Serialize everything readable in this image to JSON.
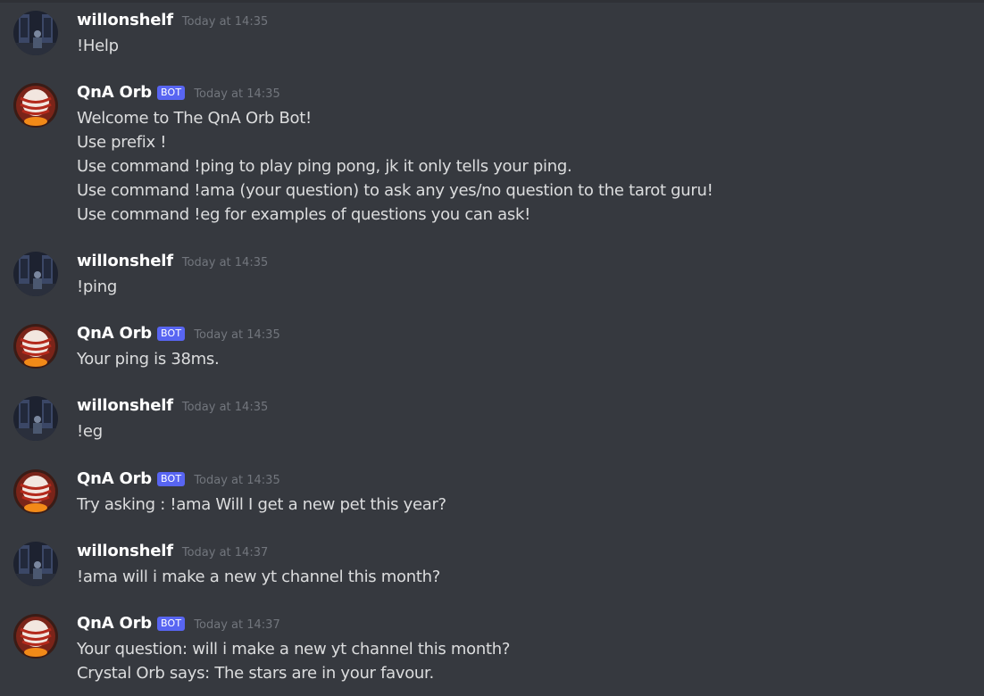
{
  "messages": [
    {
      "author": "willonshelf",
      "avatar_icon": "user-avatar-icon",
      "timestamp": "Today at 14:35",
      "lines": [
        "!Help"
      ]
    },
    {
      "author": "QnA Orb",
      "badge": "BOT",
      "avatar_icon": "crystal-orb-avatar-icon",
      "timestamp": "Today at 14:35",
      "lines": [
        "Welcome to The QnA Orb Bot!",
        "Use prefix !",
        "Use command !ping to play ping pong, jk it only tells your ping.",
        "Use command !ama (your question) to ask any yes/no question to the tarot guru!",
        "Use command !eg for examples of questions you can ask!"
      ]
    },
    {
      "author": "willonshelf",
      "avatar_icon": "user-avatar-icon",
      "timestamp": "Today at 14:35",
      "lines": [
        "!ping"
      ]
    },
    {
      "author": "QnA Orb",
      "badge": "BOT",
      "avatar_icon": "crystal-orb-avatar-icon",
      "timestamp": "Today at 14:35",
      "lines": [
        "Your ping is 38ms."
      ]
    },
    {
      "author": "willonshelf",
      "avatar_icon": "user-avatar-icon",
      "timestamp": "Today at 14:35",
      "lines": [
        "!eg"
      ]
    },
    {
      "author": "QnA Orb",
      "badge": "BOT",
      "avatar_icon": "crystal-orb-avatar-icon",
      "timestamp": "Today at 14:35",
      "lines": [
        "Try asking : !ama Will I get a new pet this year?"
      ]
    },
    {
      "author": "willonshelf",
      "avatar_icon": "user-avatar-icon",
      "timestamp": "Today at 14:37",
      "lines": [
        "!ama will i make a new yt channel this month?"
      ]
    },
    {
      "author": "QnA Orb",
      "badge": "BOT",
      "avatar_icon": "crystal-orb-avatar-icon",
      "timestamp": "Today at 14:37",
      "lines": [
        "Your question: will i make a new yt channel this month?",
        "Crystal Orb says: The stars are in your favour."
      ]
    }
  ],
  "colors": {
    "background": "#36393f",
    "username": "#ffffff",
    "message_text": "#dcddde",
    "timestamp": "#72767d",
    "bot_badge": "#5865f2"
  }
}
